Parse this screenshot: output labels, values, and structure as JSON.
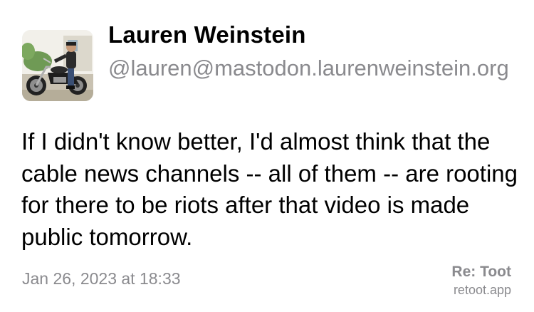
{
  "author": {
    "display_name": "Lauren Weinstein",
    "handle": "@lauren@mastodon.laurenweinstein.org",
    "avatar_icon": "motorcycle-rider-photo"
  },
  "post": {
    "text": "If I didn't know better, I'd almost think that the cable news channels -- all of them -- are rooting for there to be riots after that video is made public tomorrow.",
    "timestamp": "Jan 26, 2023 at 18:33"
  },
  "branding": {
    "name": "Re: Toot",
    "url": "retoot.app"
  },
  "colors": {
    "text": "#000000",
    "secondary": "#8a8a8e",
    "background": "#ffffff"
  }
}
